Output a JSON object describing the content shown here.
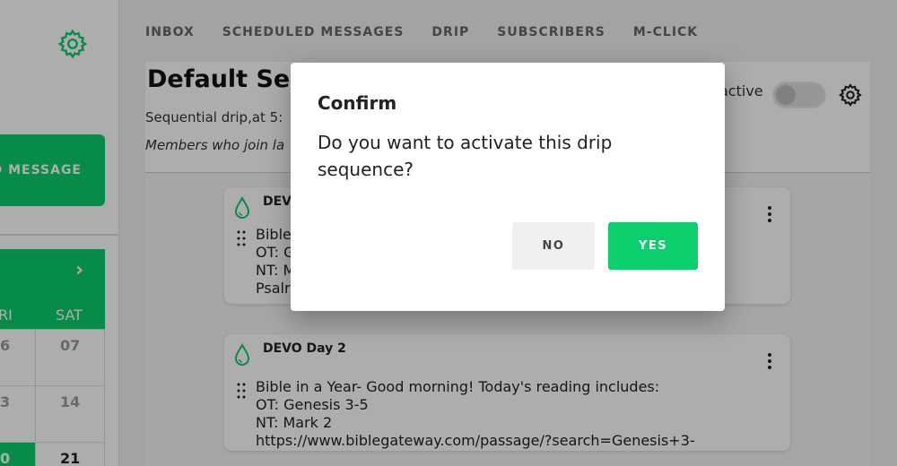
{
  "colors": {
    "accent": "#0acf6a",
    "overlay": "rgba(0,0,0,0.32)"
  },
  "sidebar": {
    "settings_icon": "gear-icon",
    "send_button_label": "D MESSAGE",
    "calendar": {
      "next_icon": "chevron-right-icon",
      "next_glyph": "›",
      "days_of_week": [
        "RI",
        "SAT"
      ],
      "rows": [
        [
          "6",
          "07"
        ],
        [
          "3",
          "14"
        ],
        [
          "0",
          "21"
        ]
      ]
    }
  },
  "nav": {
    "tabs": [
      "INBOX",
      "SCHEDULED MESSAGES",
      "DRIP",
      "SUBSCRIBERS",
      "M-CLICK"
    ]
  },
  "sequence": {
    "title": "Default Se",
    "description": "Sequential drip,at 5:",
    "members_note": "Members who join la",
    "active_label": "active",
    "active": false
  },
  "messages": [
    {
      "title": "DEVO",
      "lines": [
        "Bible",
        "OT: G",
        "NT: M",
        "Psalr"
      ]
    },
    {
      "title": "DEVO Day 2",
      "lines": [
        "Bible in a Year- Good morning! Today's reading includes:",
        "OT: Genesis 3-5",
        "NT: Mark 2",
        "https://www.biblegateway.com/passage/?search=Genesis+3-"
      ]
    }
  ],
  "dialog": {
    "title": "Confirm",
    "message": "Do you want to activate this drip sequence?",
    "no_label": "NO",
    "yes_label": "YES"
  }
}
